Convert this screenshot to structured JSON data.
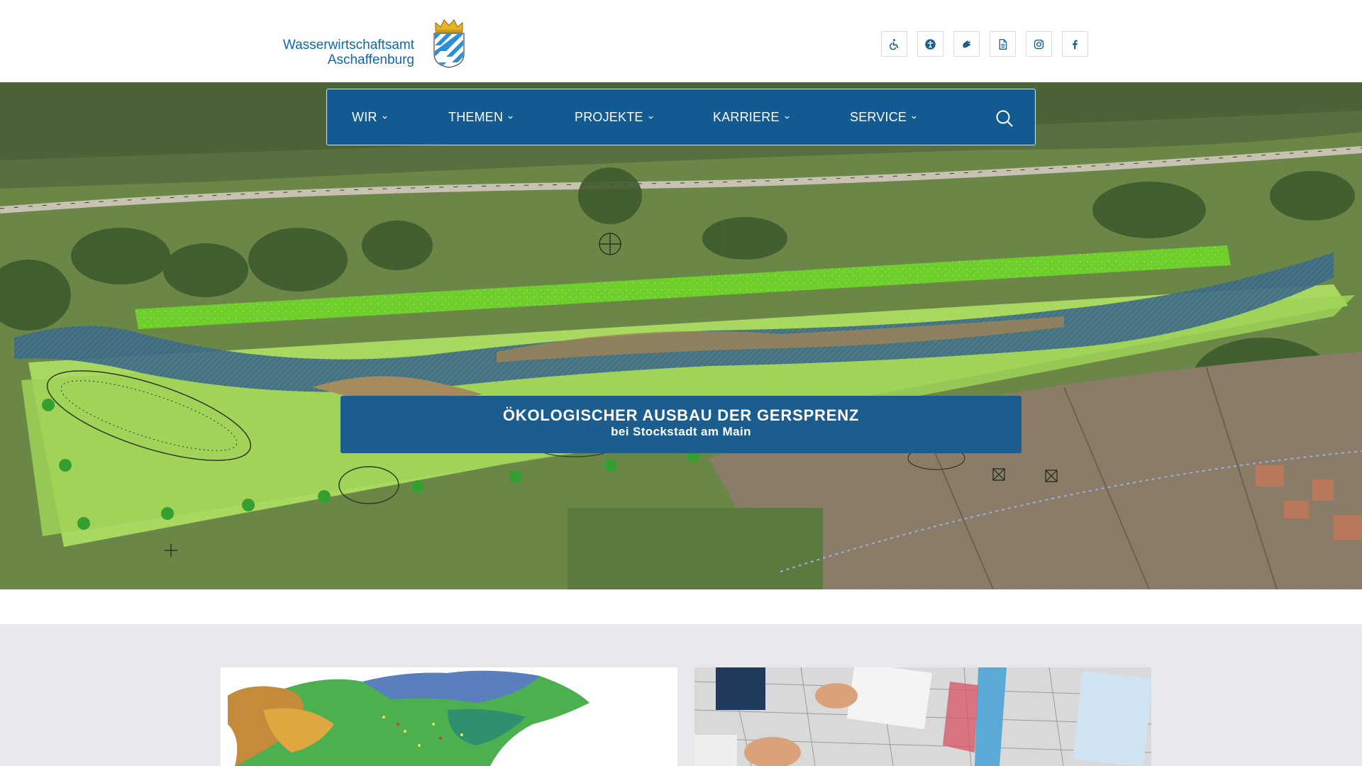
{
  "header": {
    "logo_line1": "Wasserwirtschaftsamt",
    "logo_line2": "Aschaffenburg",
    "social_icons": [
      "wheelchair-icon",
      "accessibility-icon",
      "sign-language-icon",
      "document-icon",
      "instagram-icon",
      "facebook-icon"
    ]
  },
  "nav": {
    "items": [
      {
        "label": "WIR"
      },
      {
        "label": "THEMEN"
      },
      {
        "label": "PROJEKTE"
      },
      {
        "label": "KARRIERE"
      },
      {
        "label": "SERVICE"
      }
    ]
  },
  "hero": {
    "title": "ÖKOLOGISCHER AUSBAU DER GERSPRENZ",
    "subtitle": "bei Stockstadt am Main"
  },
  "colors": {
    "brand_blue": "#125a92",
    "logo_blue": "#0e6aa8",
    "caption_blue": "#1b5d8f",
    "section_gray": "#e8e9ec"
  }
}
